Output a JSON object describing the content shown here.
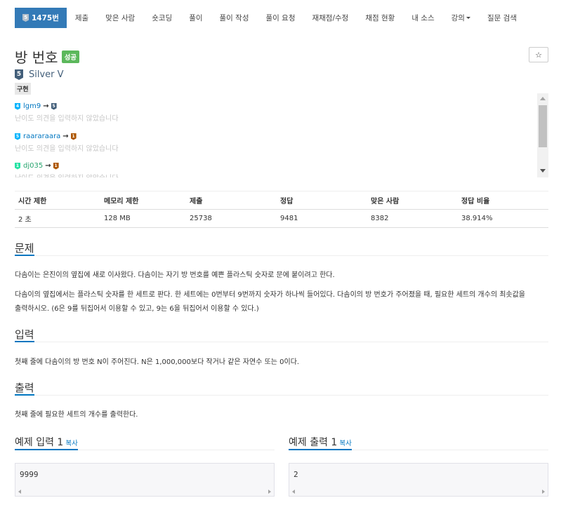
{
  "nav": {
    "problem_tier": "5",
    "problem_id": "1475번",
    "items": [
      "제출",
      "맞은 사람",
      "숏코딩",
      "풀이",
      "풀이 작성",
      "풀이 요청",
      "재채점/수정",
      "채점 현황",
      "내 소스",
      "강의",
      "질문 검색"
    ]
  },
  "header": {
    "title": "방 번호",
    "status": "성공",
    "star": "☆",
    "level_tier": "5",
    "level": "Silver V",
    "tag": "구현"
  },
  "opinions": [
    {
      "from_tier": "4",
      "user": "lgm9",
      "to_tier": "5",
      "text": "난이도 의견을 입력하지 않았습니다"
    },
    {
      "from_tier": "5",
      "user": "raararaara",
      "to_tier": "1",
      "text": "난이도 의견을 입력하지 않았습니다"
    },
    {
      "from_tier": "1",
      "user": "dj035",
      "to_tier": "1",
      "text": "난이도 의견을 입력하지 않았습니다"
    }
  ],
  "info": {
    "headers": [
      "시간 제한",
      "메모리 제한",
      "제출",
      "정답",
      "맞은 사람",
      "정답 비율"
    ],
    "values": [
      "2 초",
      "128 MB",
      "25738",
      "9481",
      "8382",
      "38.914%"
    ]
  },
  "problem": {
    "heading": "문제",
    "p1": "다솜이는 은진이의 옆집에 새로 이사왔다. 다솜이는 자기 방 번호를 예쁜 플라스틱 숫자로 문에 붙이려고 한다.",
    "p2": "다솜이의 옆집에서는 플라스틱 숫자를 한 세트로 판다. 한 세트에는 0번부터 9번까지 숫자가 하나씩 들어있다. 다솜이의 방 번호가 주어졌을 때, 필요한 세트의 개수의 최솟값을",
    "p3": "출력하시오. (6은 9를 뒤집어서 이용할 수 있고, 9는 6을 뒤집어서 이용할 수 있다.)"
  },
  "input": {
    "heading": "입력",
    "text": "첫째 줄에 다솜이의 방 번호 N이 주어진다. N은 1,000,000보다 작거나 같은 자연수 또는 0이다."
  },
  "output": {
    "heading": "출력",
    "text": "첫째 줄에 필요한 세트의 개수를 출력한다."
  },
  "samples": {
    "input_heading": "예제 입력 1",
    "output_heading": "예제 출력 1",
    "copy": "복사",
    "input_value": "9999",
    "output_value": "2"
  }
}
